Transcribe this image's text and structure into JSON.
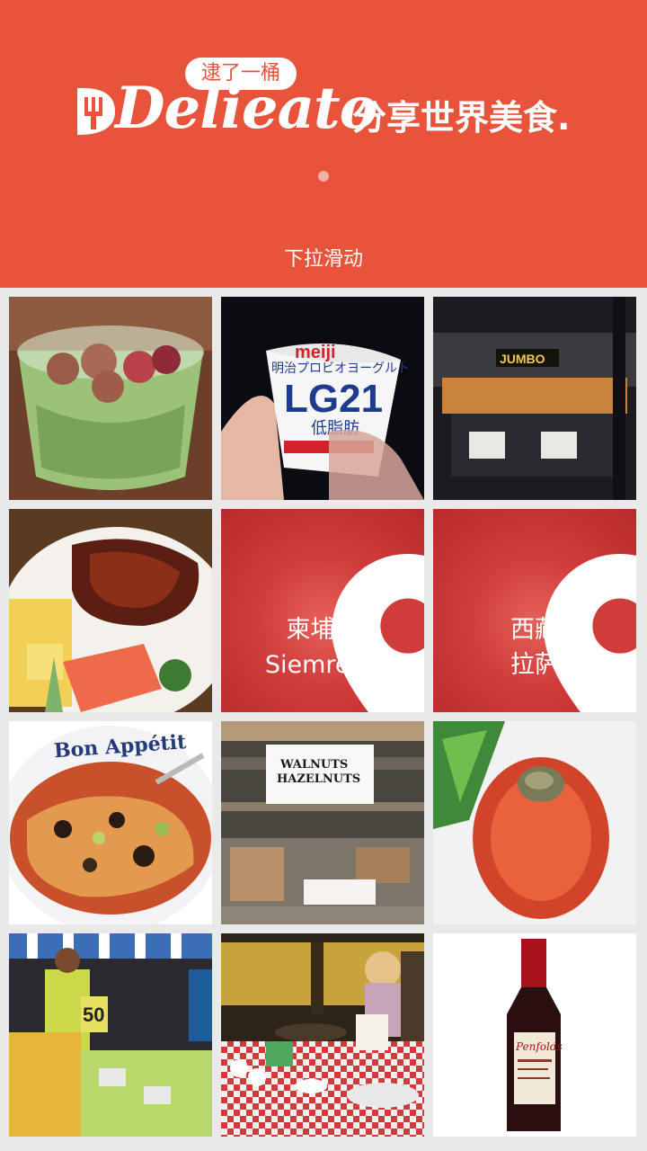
{
  "header": {
    "logo_pill": "逮了一桶",
    "logo_text": "Delieato",
    "slogan": "分享世界美食.",
    "pull_hint": "下拉滑动",
    "accent_color": "#e8533c"
  },
  "grid": {
    "tiles": [
      {
        "kind": "photo",
        "icon": "tea-glass-photo"
      },
      {
        "kind": "photo",
        "icon": "yogurt-cup-photo",
        "text": [
          "meiji",
          "明治プロビオヨーグルト",
          "LG21",
          "低脂肪"
        ]
      },
      {
        "kind": "photo",
        "icon": "restaurant-photo",
        "text": [
          "JUMBO"
        ]
      },
      {
        "kind": "photo",
        "icon": "grilled-meat-plate-photo"
      },
      {
        "kind": "location",
        "line1": "柬埔寨",
        "line2": "Siemreab"
      },
      {
        "kind": "location",
        "line1": "西藏",
        "line2": "拉萨"
      },
      {
        "kind": "photo",
        "icon": "bowl-noodles-photo",
        "text": [
          "Bon Appétit"
        ]
      },
      {
        "kind": "photo",
        "icon": "nut-stall-photo",
        "text": [
          "WALNUTS",
          "HAZELNUTS"
        ]
      },
      {
        "kind": "photo",
        "icon": "stuffed-tomato-photo"
      },
      {
        "kind": "photo",
        "icon": "market-stall-photo",
        "text": [
          "50"
        ]
      },
      {
        "kind": "photo",
        "icon": "buffet-table-photo"
      },
      {
        "kind": "photo",
        "icon": "wine-bottle-photo",
        "text": [
          "Penfolds"
        ]
      }
    ]
  }
}
